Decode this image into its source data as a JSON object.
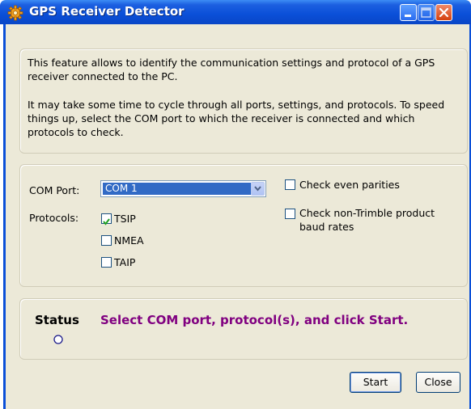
{
  "window": {
    "title": "GPS Receiver Detector",
    "icon": "gear-icon",
    "controls": [
      "minimize-icon",
      "maximize-icon",
      "close-icon"
    ],
    "titlebar_color": "#0a4fd8"
  },
  "info": {
    "paragraph1": "This feature allows to identify the communication settings and protocol of a GPS receiver connected to the PC.",
    "paragraph2": "It may take some time to cycle through all ports, settings, and protocols. To speed things up, select the COM port to which the receiver is connected and which protocols to check."
  },
  "settings": {
    "com_port_label": "COM Port:",
    "com_port_value": "COM 1",
    "protocols_label": "Protocols:",
    "protocols": [
      {
        "label": "TSIP",
        "checked": true
      },
      {
        "label": "NMEA",
        "checked": false
      },
      {
        "label": "TAIP",
        "checked": false
      }
    ],
    "check_even_parities": {
      "label": "Check even parities",
      "checked": false
    },
    "check_baud_rates": {
      "label_line1": "Check non-Trimble product",
      "label_line2": "baud rates",
      "checked": false
    }
  },
  "status": {
    "label": "Status",
    "message": "Select COM port, protocol(s), and click Start.",
    "message_color": "#800080"
  },
  "buttons": {
    "start": "Start",
    "close": "Close"
  }
}
